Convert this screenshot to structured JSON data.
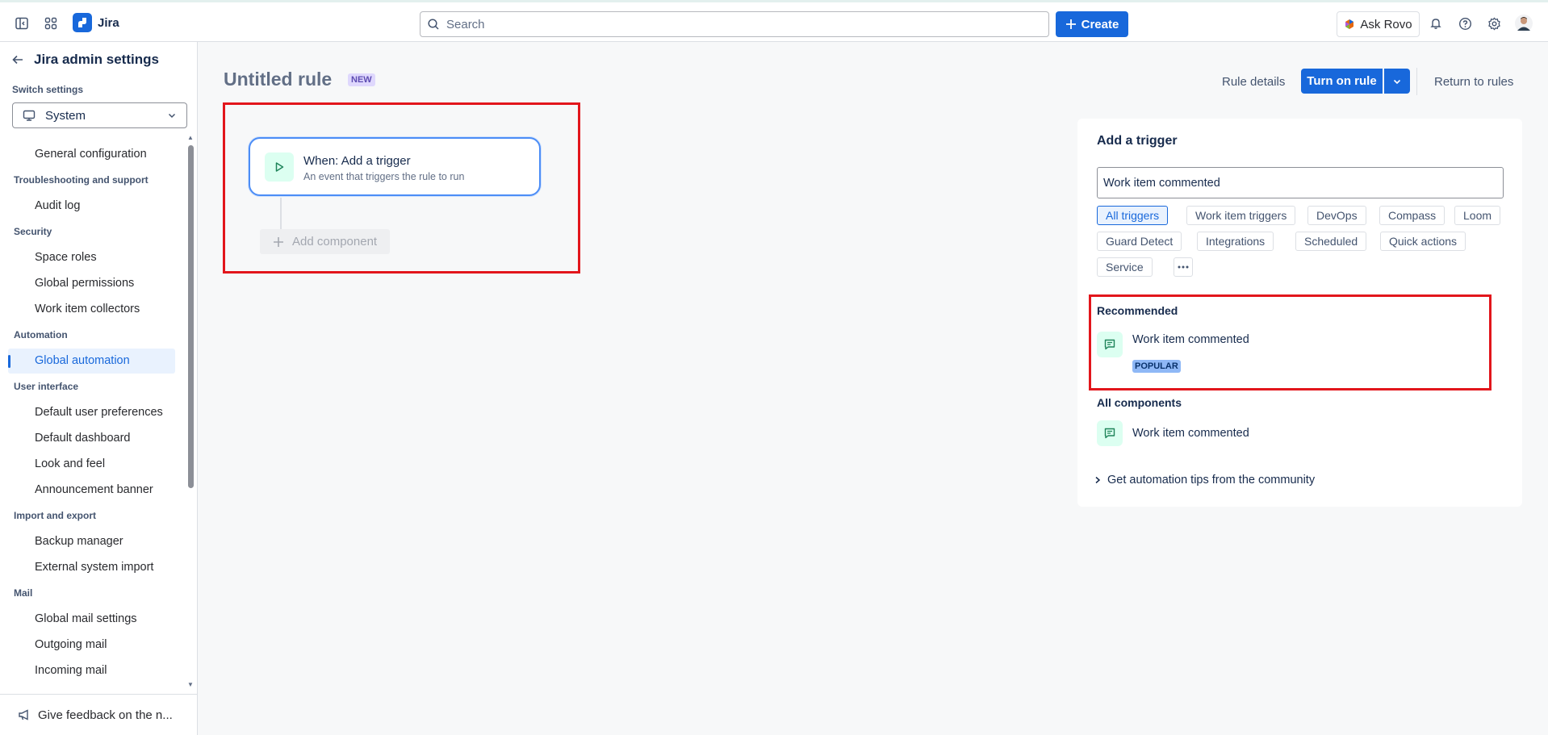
{
  "topbar": {
    "app_name": "Jira",
    "search_placeholder": "Search",
    "create_label": "Create",
    "ask_rovo_label": "Ask Rovo"
  },
  "sidebar": {
    "title": "Jira admin settings",
    "switch_label": "Switch settings",
    "switch_value": "System",
    "items": [
      {
        "type": "item",
        "label": "General configuration"
      },
      {
        "type": "section",
        "label": "Troubleshooting and support"
      },
      {
        "type": "item",
        "label": "Audit log"
      },
      {
        "type": "section",
        "label": "Security"
      },
      {
        "type": "item",
        "label": "Space roles"
      },
      {
        "type": "item",
        "label": "Global permissions"
      },
      {
        "type": "item",
        "label": "Work item collectors"
      },
      {
        "type": "section",
        "label": "Automation"
      },
      {
        "type": "item",
        "label": "Global automation",
        "active": true
      },
      {
        "type": "section",
        "label": "User interface"
      },
      {
        "type": "item",
        "label": "Default user preferences"
      },
      {
        "type": "item",
        "label": "Default dashboard"
      },
      {
        "type": "item",
        "label": "Look and feel"
      },
      {
        "type": "item",
        "label": "Announcement banner"
      },
      {
        "type": "section",
        "label": "Import and export"
      },
      {
        "type": "item",
        "label": "Backup manager"
      },
      {
        "type": "item",
        "label": "External system import"
      },
      {
        "type": "section",
        "label": "Mail"
      },
      {
        "type": "item",
        "label": "Global mail settings"
      },
      {
        "type": "item",
        "label": "Outgoing mail"
      },
      {
        "type": "item",
        "label": "Incoming mail"
      }
    ],
    "feedback_label": "Give feedback on the n..."
  },
  "rule": {
    "title": "Untitled rule",
    "badge": "NEW",
    "rule_details_label": "Rule details",
    "turn_on_label": "Turn on rule",
    "return_label": "Return to rules",
    "trigger_title": "When: Add a trigger",
    "trigger_subtitle": "An event that triggers the rule to run",
    "add_component_label": "Add component"
  },
  "panel": {
    "title": "Add a trigger",
    "search_value": "Work item commented",
    "chips": [
      {
        "label": "All triggers",
        "selected": true
      },
      {
        "label": "Work item triggers"
      },
      {
        "label": "DevOps"
      },
      {
        "label": "Compass"
      },
      {
        "label": "Loom"
      },
      {
        "label": "Guard Detect"
      },
      {
        "label": "Integrations"
      },
      {
        "label": "Scheduled"
      },
      {
        "label": "Quick actions"
      },
      {
        "label": "Service"
      }
    ],
    "recommended_label": "Recommended",
    "recommended_item": "Work item commented",
    "popular_badge": "POPULAR",
    "all_components_label": "All components",
    "all_item": "Work item commented",
    "tips_label": "Get automation tips from the community"
  },
  "colors": {
    "brand_blue": "#1868DB",
    "highlight_red": "#E2161C",
    "trigger_green_bg": "#DCFFF1"
  }
}
